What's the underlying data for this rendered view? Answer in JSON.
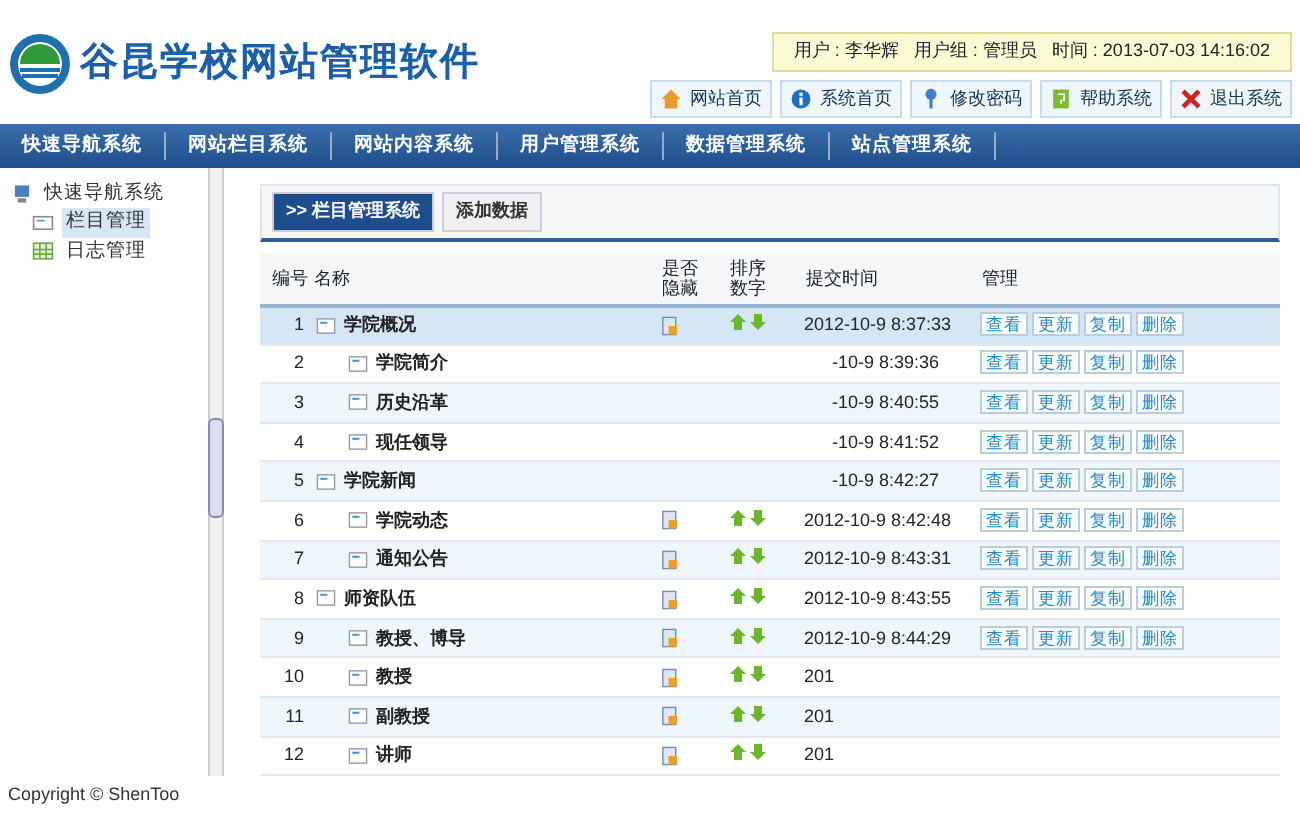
{
  "header": {
    "app_title": "谷昆学校网站管理软件",
    "user_info": "用户 : 李华辉   用户组 : 管理员   时间 : 2013-07-03 14:16:02",
    "buttons": [
      {
        "label": "网站首页",
        "kind": "home"
      },
      {
        "label": "系统首页",
        "kind": "info"
      },
      {
        "label": "修改密码",
        "kind": "key"
      },
      {
        "label": "帮助系统",
        "kind": "help"
      },
      {
        "label": "退出系统",
        "kind": "exit"
      }
    ]
  },
  "nav": [
    "快速导航系统",
    "网站栏目系统",
    "网站内容系统",
    "用户管理系统",
    "数据管理系统",
    "站点管理系统"
  ],
  "sidebar": {
    "root": "快速导航系统",
    "children": [
      {
        "label": "栏目管理",
        "kind": "column",
        "selected": true
      },
      {
        "label": "日志管理",
        "kind": "log",
        "selected": false
      }
    ]
  },
  "tabs": [
    {
      "label": ">> 栏目管理系统",
      "selected": true
    },
    {
      "label": "添加数据",
      "selected": false
    }
  ],
  "table": {
    "columns": [
      "编号",
      "名称",
      "是否隐藏",
      "排序数字",
      "提交时间",
      "管理"
    ],
    "rows": [
      {
        "no": "1",
        "name": "学院概况",
        "children": [
          {
            "no": "2",
            "name": "学院简介",
            "time": "-10-9 8:39:36",
            "actions": [
              "查看",
              "更新",
              "复制",
              "删除"
            ]
          },
          {
            "no": "3",
            "name": "历史沿革",
            "time": "-10-9 8:40:55",
            "actions": [
              "查看",
              "更新",
              "复制",
              "删除"
            ]
          },
          {
            "no": "4",
            "name": "现任领导",
            "time": "-10-9 8:41:52",
            "actions": [
              "查看",
              "更新",
              "复制",
              "删除"
            ]
          }
        ],
        "time": "2012-10-9 8:37:33",
        "actions": [
          "查看",
          "更新",
          "复制",
          "删除"
        ],
        "selected": true,
        "icons": true
      },
      {
        "no": "5",
        "name": "学院新闻",
        "children": [
          {
            "no": "6",
            "name": "学院动态",
            "time": "2012-10-9 8:42:48",
            "actions": [
              "查看",
              "更新",
              "复制",
              "删除"
            ],
            "icons": true
          },
          {
            "no": "7",
            "name": "通知公告",
            "time": "2012-10-9 8:43:31",
            "actions": [
              "查看",
              "更新",
              "复制",
              "删除"
            ],
            "icons": true
          }
        ],
        "time": "-10-9 8:42:27",
        "actions": [
          "查看",
          "更新",
          "复制",
          "删除"
        ],
        "selected": false
      },
      {
        "no": "8",
        "name": "师资队伍",
        "children": [
          {
            "no": "9",
            "name": "教授、博导",
            "time": "2012-10-9 8:44:29",
            "actions": [
              "查看",
              "更新",
              "复制",
              "删除"
            ],
            "icons": true
          },
          {
            "no": "10",
            "name": "教授",
            "time": "201",
            "icons": true
          },
          {
            "no": "11",
            "name": "副教授",
            "time": "201",
            "icons": true
          },
          {
            "no": "12",
            "name": "讲师",
            "time": "201",
            "icons": true
          }
        ],
        "time": "2012-10-9 8:43:55",
        "actions": [
          "查看",
          "更新",
          "复制",
          "删除"
        ],
        "selected": false,
        "icons": true
      }
    ]
  },
  "footer": "Copyright © ShenToo"
}
